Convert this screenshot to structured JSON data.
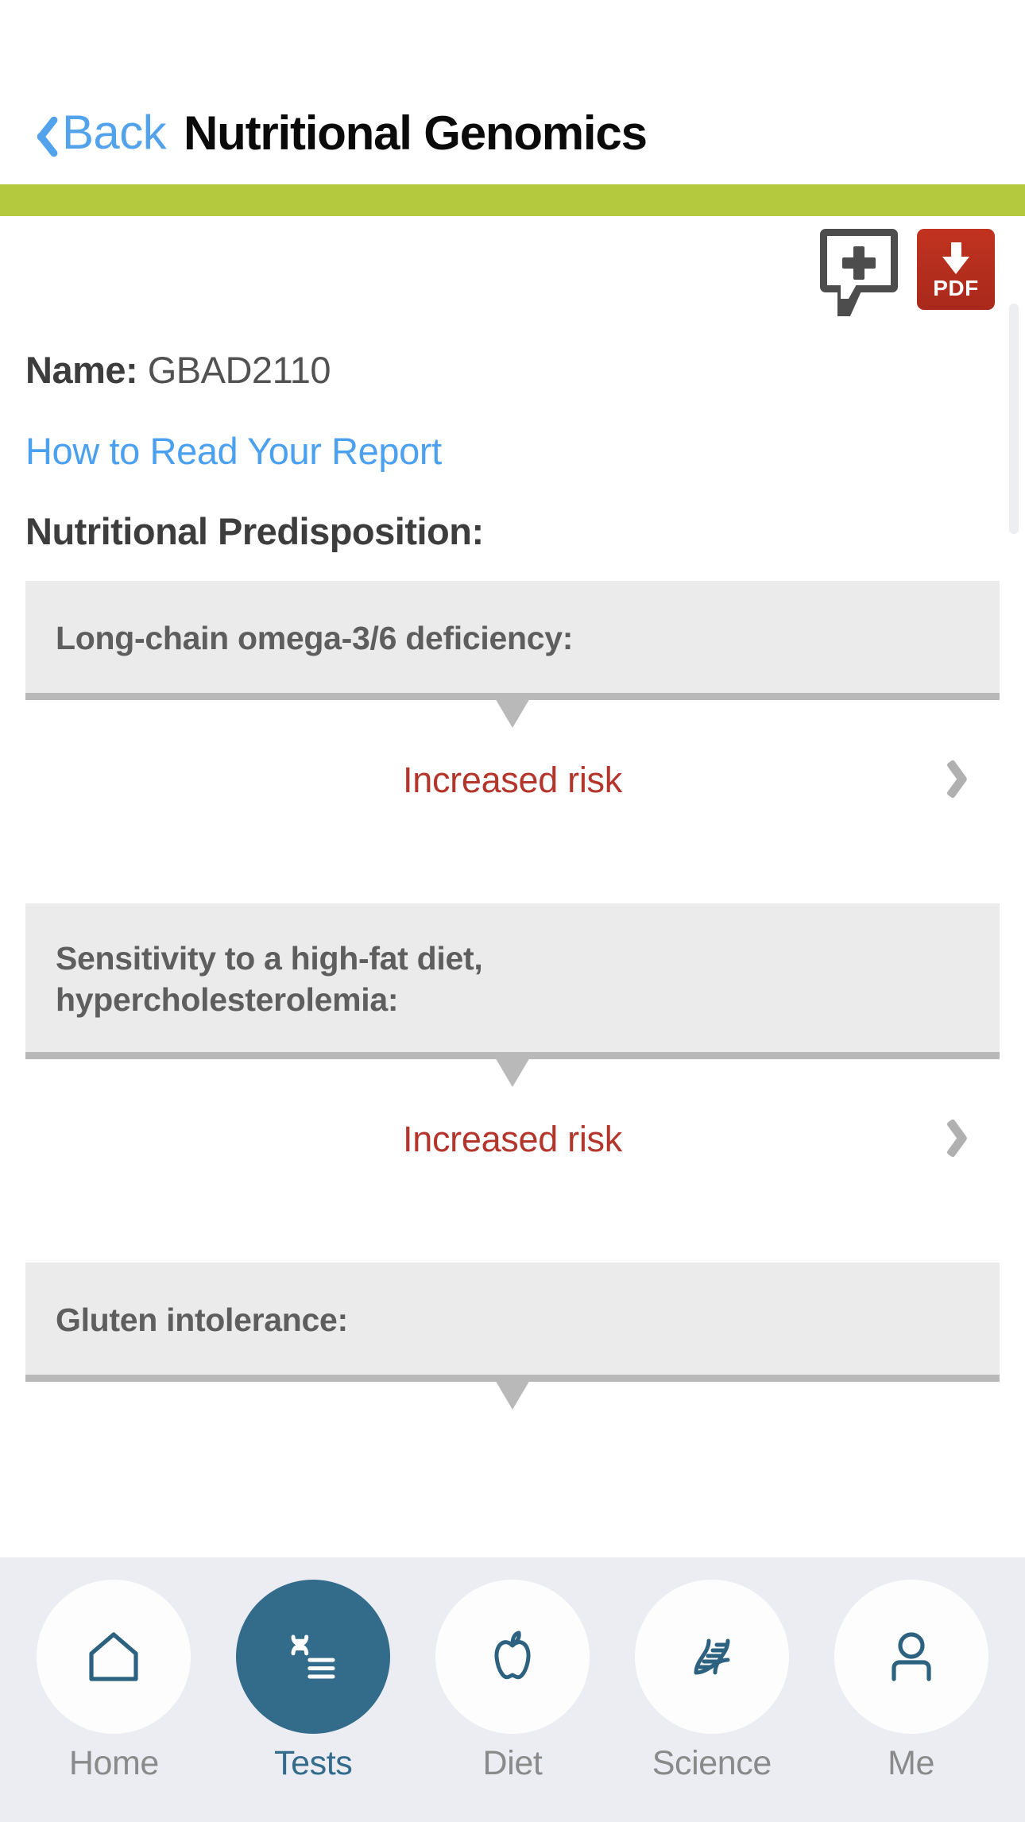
{
  "navbar": {
    "back_label": "Back",
    "title": "Nutritional Genomics",
    "back_icon": "chevron-left-icon",
    "accent_color": "#b5c93f",
    "back_color": "#52a2ec"
  },
  "actions": {
    "add_note": {
      "icon": "speech-bubble-plus-icon",
      "label": ""
    },
    "download_pdf": {
      "icon": "download-arrow-icon",
      "label": "PDF",
      "color": "#b52f1e"
    }
  },
  "report": {
    "name_label": "Name:",
    "name_value": "GBAD2110",
    "how_to_read_link": "How to Read Your Report",
    "section_title": "Nutritional Predisposition:"
  },
  "results": [
    {
      "condition": "Long-chain omega-3/6 deficiency:",
      "risk": "Increased risk",
      "risk_color": "#b4352b",
      "chevron": "chevron-right-icon"
    },
    {
      "condition": "Sensitivity to a high-fat diet,\nhypercholesterolemia:",
      "risk": "Increased risk",
      "risk_color": "#b4352b",
      "chevron": "chevron-right-icon"
    },
    {
      "condition": "Gluten intolerance:",
      "risk": "",
      "risk_color": "#b4352b",
      "chevron": "chevron-right-icon"
    }
  ],
  "tabbar": {
    "active_color": "#336b8b",
    "inactive_color": "#8a8a8a",
    "items": [
      {
        "label": "Home",
        "icon": "home-icon",
        "active": false
      },
      {
        "label": "Tests",
        "icon": "dna-list-icon",
        "active": true
      },
      {
        "label": "Diet",
        "icon": "apple-icon",
        "active": false
      },
      {
        "label": "Science",
        "icon": "dna-helix-icon",
        "active": false
      },
      {
        "label": "Me",
        "icon": "person-icon",
        "active": false
      }
    ]
  }
}
